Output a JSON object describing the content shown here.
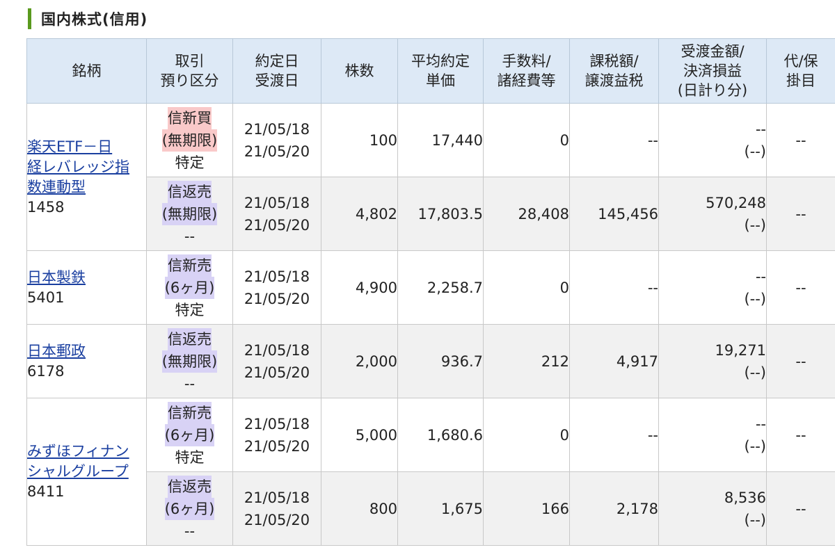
{
  "section": {
    "title": "国内株式(信用)"
  },
  "headers": [
    [
      "銘柄"
    ],
    [
      "取引",
      "預り区分"
    ],
    [
      "約定日",
      "受渡日"
    ],
    [
      "株数"
    ],
    [
      "平均約定",
      "単価"
    ],
    [
      "手数料/",
      "諸経費等"
    ],
    [
      "課税額/",
      "譲渡益税"
    ],
    [
      "受渡金額/",
      "決済損益",
      "(日計り分)"
    ],
    [
      "代/保",
      "掛目"
    ]
  ],
  "colors": {
    "accent_bar": "#5a9a1e",
    "header_bg": "#dde9f6",
    "buy_tag": "#f9c9c9",
    "sell_tag": "#d8d2f5",
    "link": "#1a3fa0"
  },
  "stocks": [
    {
      "name_lines": [
        "楽天ETF－日",
        "経レバレッジ指",
        "数連動型"
      ],
      "code": "1458",
      "rows": [
        {
          "trade_type": "信新買",
          "trade_type_kind": "buy",
          "term": "(無期限)",
          "account": "特定",
          "trade_date": "21/05/18",
          "settle_date": "21/05/20",
          "shares": "100",
          "price": "17,440",
          "fee": "0",
          "tax": "--",
          "amount": "--",
          "daytrade_pl": "(--)",
          "margin": "--"
        },
        {
          "trade_type": "信返売",
          "trade_type_kind": "sell",
          "term": "(無期限)",
          "account": "--",
          "trade_date": "21/05/18",
          "settle_date": "21/05/20",
          "shares": "4,802",
          "price": "17,803.5",
          "fee": "28,408",
          "tax": "145,456",
          "amount": "570,248",
          "daytrade_pl": "(--)",
          "margin": "--"
        }
      ]
    },
    {
      "name_lines": [
        "日本製鉄"
      ],
      "code": "5401",
      "rows": [
        {
          "trade_type": "信新売",
          "trade_type_kind": "sell",
          "term": "(6ヶ月)",
          "account": "特定",
          "trade_date": "21/05/18",
          "settle_date": "21/05/20",
          "shares": "4,900",
          "price": "2,258.7",
          "fee": "0",
          "tax": "--",
          "amount": "--",
          "daytrade_pl": "(--)",
          "margin": "--"
        }
      ]
    },
    {
      "name_lines": [
        "日本郵政"
      ],
      "code": "6178",
      "rows": [
        {
          "trade_type": "信返売",
          "trade_type_kind": "sell",
          "term": "(無期限)",
          "account": "--",
          "trade_date": "21/05/18",
          "settle_date": "21/05/20",
          "shares": "2,000",
          "price": "936.7",
          "fee": "212",
          "tax": "4,917",
          "amount": "19,271",
          "daytrade_pl": "(--)",
          "margin": "--"
        }
      ]
    },
    {
      "name_lines": [
        "みずほフィナン",
        "シャルグループ"
      ],
      "code": "8411",
      "rows": [
        {
          "trade_type": "信新売",
          "trade_type_kind": "sell",
          "term": "(6ヶ月)",
          "account": "特定",
          "trade_date": "21/05/18",
          "settle_date": "21/05/20",
          "shares": "5,000",
          "price": "1,680.6",
          "fee": "0",
          "tax": "--",
          "amount": "--",
          "daytrade_pl": "(--)",
          "margin": "--"
        },
        {
          "trade_type": "信返売",
          "trade_type_kind": "sell",
          "term": "(6ヶ月)",
          "account": "--",
          "trade_date": "21/05/18",
          "settle_date": "21/05/20",
          "shares": "800",
          "price": "1,675",
          "fee": "166",
          "tax": "2,178",
          "amount": "8,536",
          "daytrade_pl": "(--)",
          "margin": "--"
        }
      ]
    }
  ]
}
